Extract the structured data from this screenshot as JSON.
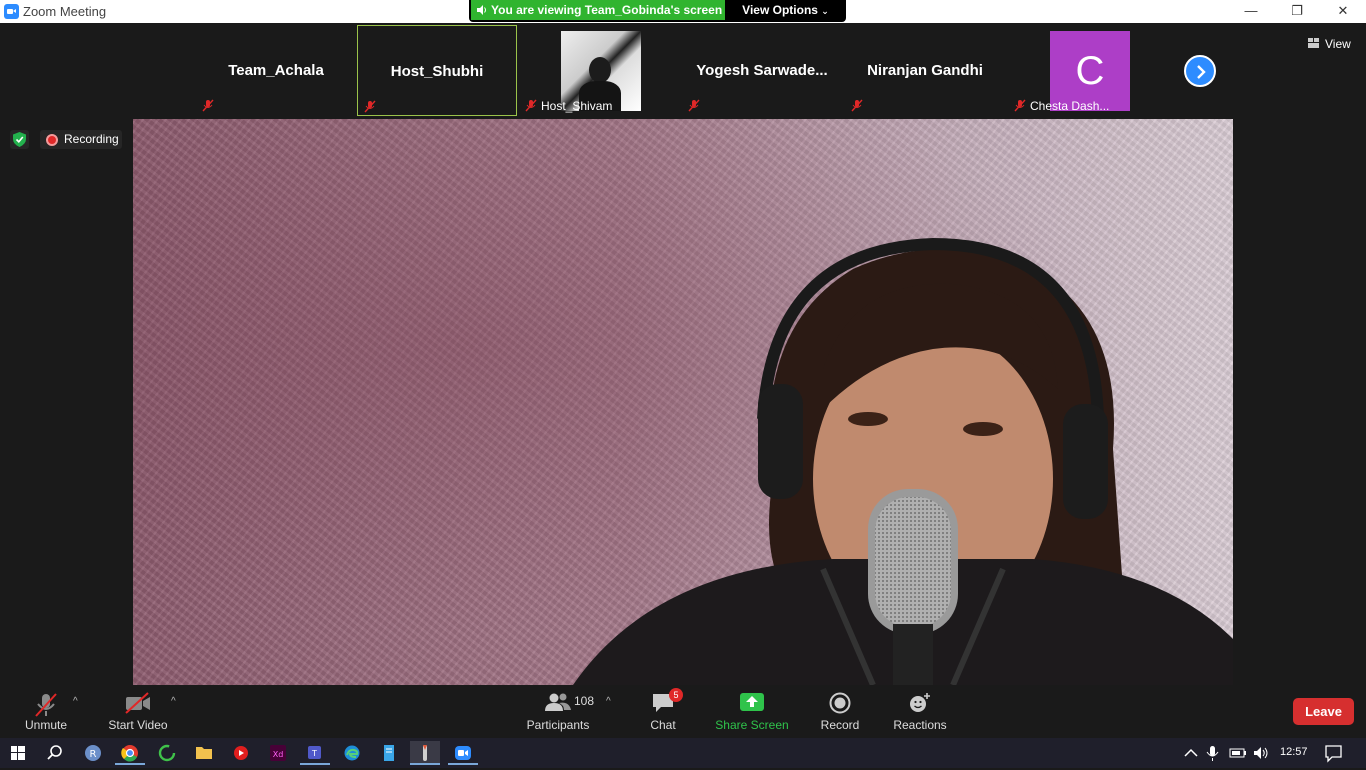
{
  "window": {
    "title": "Zoom Meeting",
    "minimize": "—",
    "restore": "❐",
    "close": "✕"
  },
  "banner": {
    "viewing_text": "You are viewing Team_Gobinda's screen",
    "view_options": "View Options",
    "color": "#30b42f"
  },
  "participants_strip": {
    "thumbs": [
      {
        "name": "Team_Achala",
        "muted": true
      },
      {
        "name": "Host_Shubhi",
        "muted": true,
        "active": true
      },
      {
        "name": "Host_Shivam",
        "muted": true,
        "has_video": true
      },
      {
        "name": "Yogesh  Sarwade...",
        "muted": true
      },
      {
        "name": "Niranjan Gandhi",
        "muted": true
      },
      {
        "name": "Chesta Dash...",
        "muted": true,
        "avatar_letter": "C",
        "avatar_color": "#ad3ec7"
      }
    ],
    "view_label": "View"
  },
  "status": {
    "recording_label": "Recording"
  },
  "toolbar": {
    "unmute": "Unmute",
    "start_video": "Start Video",
    "participants": "Participants",
    "participants_count": "108",
    "chat": "Chat",
    "chat_badge": "5",
    "share_screen": "Share Screen",
    "record": "Record",
    "reactions": "Reactions",
    "leave": "Leave",
    "caret": "^"
  },
  "taskbar": {
    "time": "12:57",
    "profile_letter": "R"
  },
  "colors": {
    "accent": "#2d8cff",
    "share_green": "#2fc34b",
    "leave_red": "#d62f2f"
  }
}
